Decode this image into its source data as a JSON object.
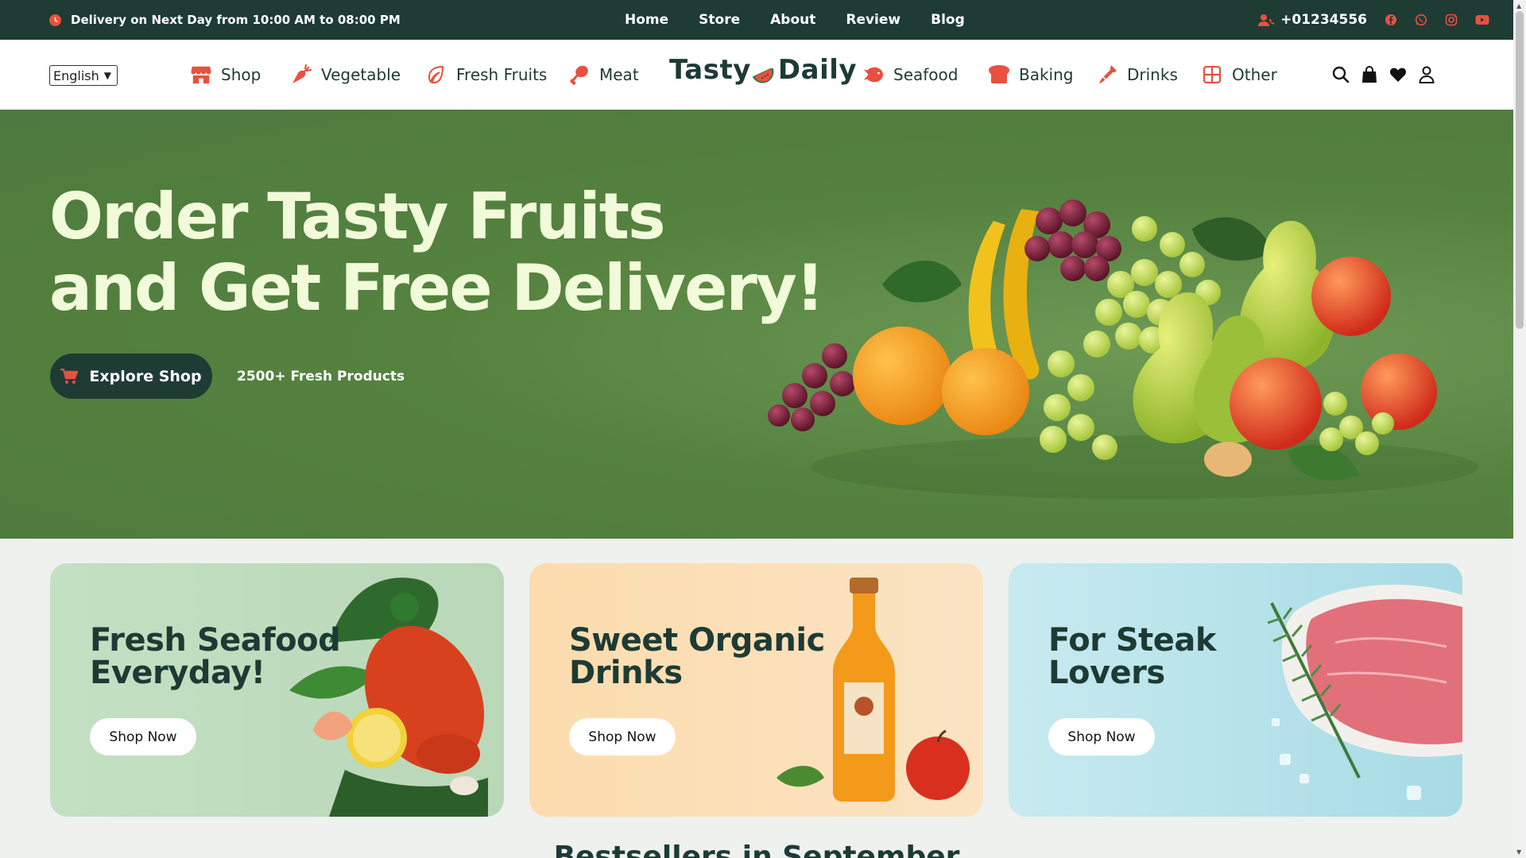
{
  "topbar": {
    "delivery_text": "Delivery on Next Day from 10:00 AM to 08:00 PM",
    "nav": [
      "Home",
      "Store",
      "About",
      "Review",
      "Blog"
    ],
    "phone": "+01234556",
    "social_icons": [
      "facebook-icon",
      "whatsapp-icon",
      "instagram-icon",
      "youtube-icon"
    ]
  },
  "navbar": {
    "language": "English",
    "categories": [
      {
        "label": "Shop",
        "icon": "store-icon"
      },
      {
        "label": "Vegetable",
        "icon": "carrot-icon"
      },
      {
        "label": "Fresh Fruits",
        "icon": "leaf-icon"
      },
      {
        "label": "Meat",
        "icon": "drumstick-icon"
      },
      {
        "label": "Seafood",
        "icon": "fish-icon"
      },
      {
        "label": "Baking",
        "icon": "bread-icon"
      },
      {
        "label": "Drinks",
        "icon": "bottle-icon"
      },
      {
        "label": "Other",
        "icon": "grid-icon"
      }
    ],
    "logo_left": "Tasty",
    "logo_right": "Daily",
    "action_icons": [
      "search-icon",
      "bag-icon",
      "heart-icon",
      "user-icon"
    ]
  },
  "hero": {
    "title_line1": "Order Tasty Fruits",
    "title_line2": "and Get Free Delivery!",
    "cta_label": "Explore Shop",
    "product_count": "2500+ Fresh Products"
  },
  "promos": [
    {
      "title_line1": "Fresh Seafood",
      "title_line2": "Everyday!",
      "button": "Shop Now"
    },
    {
      "title_line1": "Sweet Organic",
      "title_line2": "Drinks",
      "button": "Shop Now"
    },
    {
      "title_line1": "For Steak",
      "title_line2": "Lovers",
      "button": "Shop Now"
    }
  ],
  "section_title": "Bestsellers in September",
  "colors": {
    "dark_green": "#1e3b34",
    "accent_red": "#e8513f",
    "hero_green": "#55823f",
    "hero_text": "#f2fbd9"
  }
}
